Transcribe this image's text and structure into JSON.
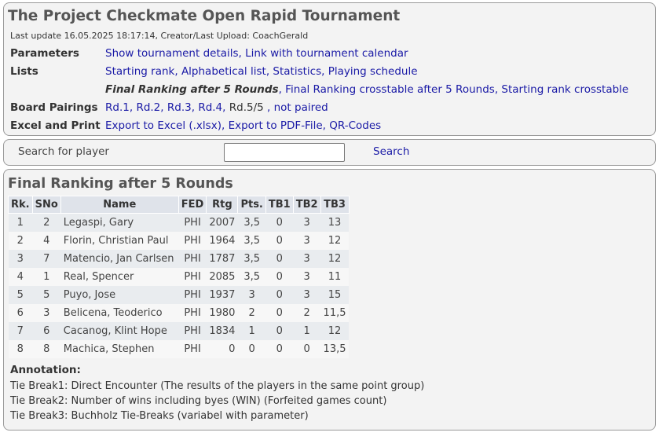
{
  "header": {
    "title": "The Project Checkmate Open Rapid Tournament",
    "last_update": "Last update 16.05.2025 18:17:14, Creator/Last Upload: CoachGerald",
    "parameters": {
      "label": "Parameters",
      "details": "Show tournament details",
      "calendar": "Link with tournament calendar"
    },
    "lists": {
      "label": "Lists",
      "starting_rank": "Starting rank",
      "alphabetical": "Alphabetical list",
      "statistics": "Statistics",
      "schedule": "Playing schedule",
      "final_ranking": "Final Ranking after 5 Rounds",
      "final_crosstable": "Final Ranking crosstable after 5 Rounds",
      "starting_crosstable": "Starting rank crosstable"
    },
    "pairings": {
      "label": "Board Pairings",
      "rd1": "Rd.1",
      "rd2": "Rd.2",
      "rd3": "Rd.3",
      "rd4": "Rd.4",
      "rd5": "Rd.5/5",
      "not_paired": "not paired"
    },
    "excel": {
      "label": "Excel and Print",
      "xlsx": "Export to Excel (.xlsx)",
      "pdf": "Export to PDF-File",
      "qr": "QR-Codes"
    }
  },
  "search": {
    "label": "Search for player",
    "value": "",
    "button": "Search"
  },
  "ranking": {
    "title": "Final Ranking after 5 Rounds",
    "columns": [
      "Rk.",
      "SNo",
      "Name",
      "FED",
      "Rtg",
      "Pts.",
      "TB1",
      "TB2",
      "TB3"
    ],
    "rows": [
      {
        "rk": "1",
        "sno": "2",
        "name": "Legaspi, Gary",
        "fed": "PHI",
        "rtg": "2007",
        "pts": "3,5",
        "tb1": "0",
        "tb2": "3",
        "tb3": "13"
      },
      {
        "rk": "2",
        "sno": "4",
        "name": "Florin, Christian Paul",
        "fed": "PHI",
        "rtg": "1964",
        "pts": "3,5",
        "tb1": "0",
        "tb2": "3",
        "tb3": "12"
      },
      {
        "rk": "3",
        "sno": "7",
        "name": "Matencio, Jan Carlsen",
        "fed": "PHI",
        "rtg": "1787",
        "pts": "3,5",
        "tb1": "0",
        "tb2": "3",
        "tb3": "12"
      },
      {
        "rk": "4",
        "sno": "1",
        "name": "Real, Spencer",
        "fed": "PHI",
        "rtg": "2085",
        "pts": "3,5",
        "tb1": "0",
        "tb2": "3",
        "tb3": "11"
      },
      {
        "rk": "5",
        "sno": "5",
        "name": "Puyo, Jose",
        "fed": "PHI",
        "rtg": "1937",
        "pts": "3",
        "tb1": "0",
        "tb2": "3",
        "tb3": "15"
      },
      {
        "rk": "6",
        "sno": "3",
        "name": "Belicena, Teoderico",
        "fed": "PHI",
        "rtg": "1980",
        "pts": "2",
        "tb1": "0",
        "tb2": "2",
        "tb3": "11,5"
      },
      {
        "rk": "7",
        "sno": "6",
        "name": "Cacanog, Klint Hope",
        "fed": "PHI",
        "rtg": "1834",
        "pts": "1",
        "tb1": "0",
        "tb2": "1",
        "tb3": "12"
      },
      {
        "rk": "8",
        "sno": "8",
        "name": "Machica, Stephen",
        "fed": "PHI",
        "rtg": "0",
        "pts": "0",
        "tb1": "0",
        "tb2": "0",
        "tb3": "13,5"
      }
    ]
  },
  "annotation": {
    "label": "Annotation:",
    "tb1": "Tie Break1: Direct Encounter (The results of the players in the same point group)",
    "tb2": "Tie Break2: Number of wins including byes (WIN) (Forfeited games count)",
    "tb3": "Tie Break3: Buchholz Tie-Breaks (variabel with parameter)"
  }
}
